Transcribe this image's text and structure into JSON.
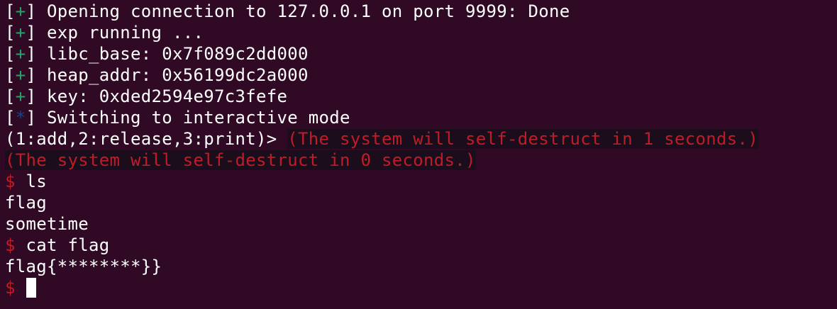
{
  "terminal": {
    "colors": {
      "background": "#300a24",
      "foreground": "#ffffff",
      "status_plus": "#26a269",
      "status_star": "#12488b",
      "prompt_red": "#c01c28"
    },
    "status_lines": [
      {
        "marker": "+",
        "text": " Opening connection to 127.0.0.1 on port 9999: Done"
      },
      {
        "marker": "+",
        "text": " exp running ..."
      },
      {
        "marker": "+",
        "text": " libc_base: 0x7f089c2dd000"
      },
      {
        "marker": "+",
        "text": " heap_addr: 0x56199dc2a000"
      },
      {
        "marker": "+",
        "text": " key: 0xded2594e97c3fefe"
      },
      {
        "marker": "*",
        "text": " Switching to interactive mode"
      }
    ],
    "menu_prompt": "(1:add,2:release,3:print)>",
    "warning_1": "(The system will self-destruct in 1 seconds.)",
    "warning_0": "(The system will self-destruct in 0 seconds.)",
    "shell_prompt": "$",
    "commands": [
      {
        "cmd": " ls",
        "output": [
          "flag",
          "sometime"
        ]
      },
      {
        "cmd": " cat flag",
        "output": [
          "flag{********}}"
        ]
      }
    ]
  }
}
